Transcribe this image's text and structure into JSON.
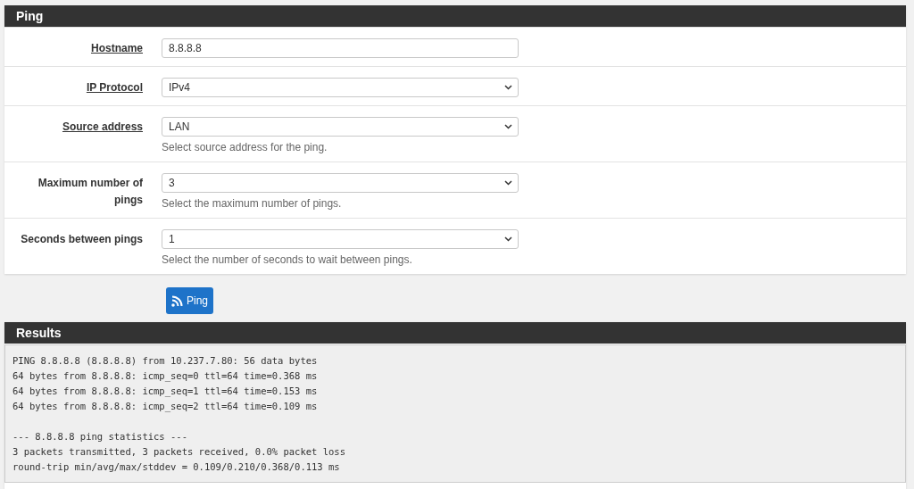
{
  "form_panel": {
    "title": "Ping",
    "rows": [
      {
        "label": "Hostname",
        "underlined": true,
        "kind": "text",
        "value": "8.8.8.8"
      },
      {
        "label": "IP Protocol",
        "underlined": true,
        "kind": "select",
        "value": "IPv4"
      },
      {
        "label": "Source address",
        "underlined": true,
        "kind": "select",
        "value": "LAN",
        "help": "Select source address for the ping."
      },
      {
        "label": "Maximum number of pings",
        "underlined": false,
        "kind": "select",
        "value": "3",
        "help": "Select the maximum number of pings."
      },
      {
        "label": "Seconds between pings",
        "underlined": false,
        "kind": "select",
        "value": "1",
        "help": "Select the number of seconds to wait between pings."
      }
    ]
  },
  "ping_button": {
    "label": "Ping"
  },
  "results_panel": {
    "title": "Results",
    "output_blocks": [
      [
        "PING 8.8.8.8 (8.8.8.8) from 10.237.7.80: 56 data bytes",
        "64 bytes from 8.8.8.8: icmp_seq=0 ttl=64 time=0.368 ms",
        "64 bytes from 8.8.8.8: icmp_seq=1 ttl=64 time=0.153 ms",
        "64 bytes from 8.8.8.8: icmp_seq=2 ttl=64 time=0.109 ms"
      ],
      [
        "--- 8.8.8.8 ping statistics ---",
        "3 packets transmitted, 3 packets received, 0.0% packet loss",
        "round-trip min/avg/max/stddev = 0.109/0.210/0.368/0.113 ms"
      ]
    ]
  }
}
